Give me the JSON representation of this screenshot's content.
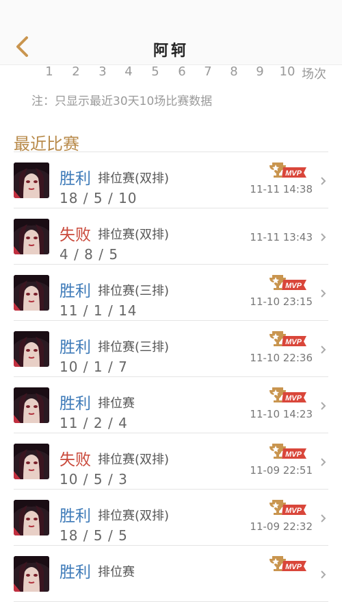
{
  "header": {
    "title": "阿轲"
  },
  "scale": {
    "numbers": [
      "1",
      "2",
      "3",
      "4",
      "5",
      "6",
      "7",
      "8",
      "9",
      "10"
    ],
    "unit": "场次"
  },
  "note": "注：只显示最近30天10场比赛数据",
  "section": {
    "title": "最近比赛"
  },
  "colors": {
    "accent": "#b88a4a",
    "win": "#3d7ab8",
    "lose": "#c9483a"
  },
  "icons": {
    "back": "chevron-left-icon",
    "mvp": "mvp-trophy-icon",
    "row_arrow": "chevron-right-icon"
  },
  "matches": [
    {
      "result": "胜利",
      "outcome": "win",
      "mode": "排位赛(双排)",
      "kda": "18 / 5 / 10",
      "time": "11-11 14:38",
      "mvp": true
    },
    {
      "result": "失败",
      "outcome": "lose",
      "mode": "排位赛(双排)",
      "kda": "4 / 8 / 5",
      "time": "11-11 13:43",
      "mvp": false
    },
    {
      "result": "胜利",
      "outcome": "win",
      "mode": "排位赛(三排)",
      "kda": "11 / 1 / 14",
      "time": "11-10 23:15",
      "mvp": true
    },
    {
      "result": "胜利",
      "outcome": "win",
      "mode": "排位赛(三排)",
      "kda": "10 / 1 / 7",
      "time": "11-10 22:36",
      "mvp": true
    },
    {
      "result": "胜利",
      "outcome": "win",
      "mode": "排位赛",
      "kda": "11 / 2 / 4",
      "time": "11-10 14:23",
      "mvp": true
    },
    {
      "result": "失败",
      "outcome": "lose",
      "mode": "排位赛(双排)",
      "kda": "10 / 5 / 3",
      "time": "11-09 22:51",
      "mvp": true
    },
    {
      "result": "胜利",
      "outcome": "win",
      "mode": "排位赛(双排)",
      "kda": "18 / 5 / 5",
      "time": "11-09 22:32",
      "mvp": true
    },
    {
      "result": "胜利",
      "outcome": "win",
      "mode": "排位赛",
      "kda": "",
      "time": "",
      "mvp": true
    }
  ]
}
